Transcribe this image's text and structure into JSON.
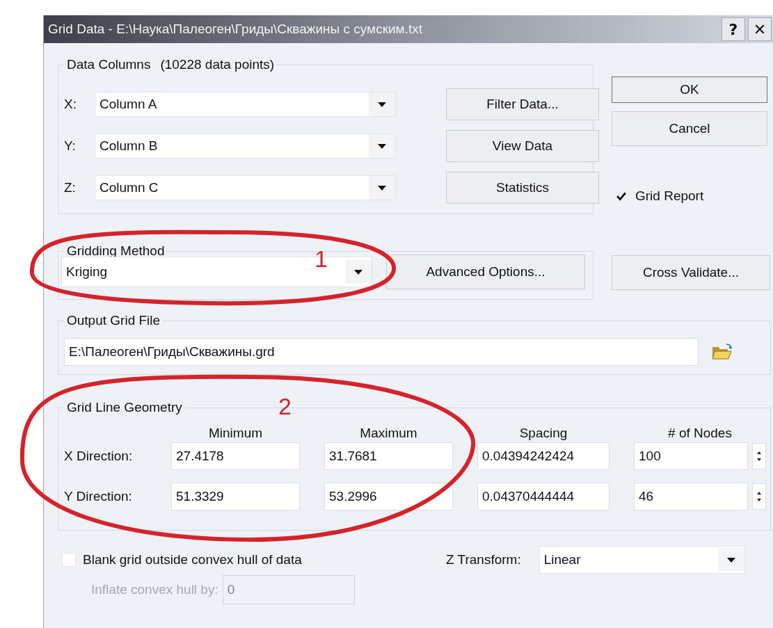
{
  "window": {
    "title": "Grid Data - E:\\Наука\\Палеоген\\Гриды\\Скважины с сумским.txt",
    "help": "?",
    "close": "✕"
  },
  "data_columns": {
    "label": "Data Columns",
    "count": "(10228 data points)",
    "rows": [
      {
        "axis": "X:",
        "value": "Column A",
        "button": "Filter Data..."
      },
      {
        "axis": "Y:",
        "value": "Column B",
        "button": "View Data"
      },
      {
        "axis": "Z:",
        "value": "Column C",
        "button": "Statistics"
      }
    ]
  },
  "dialog_buttons": [
    {
      "label": "OK",
      "default": true
    },
    {
      "label": "Cancel",
      "default": false
    }
  ],
  "grid_report": {
    "label": "Grid Report",
    "checked": true
  },
  "gridding_method": {
    "label": "Gridding Method",
    "value": "Kriging",
    "button": "Advanced Options..."
  },
  "cross_validate": "Cross Validate...",
  "output_grid_file": {
    "label": "Output Grid File",
    "value": "E:\\Палеоген\\Гриды\\Скважины.grd"
  },
  "grid_line_geometry": {
    "label": "Grid Line Geometry",
    "columns": [
      "Minimum",
      "Maximum",
      "Spacing",
      "# of Nodes"
    ],
    "rows": [
      {
        "label": "X Direction:",
        "minimum": "27.4178",
        "maximum": "31.7681",
        "spacing": "0.04394242424",
        "nodes": "100"
      },
      {
        "label": "Y Direction:",
        "minimum": "51.3329",
        "maximum": "53.2996",
        "spacing": "0.04370444444",
        "nodes": "46"
      }
    ]
  },
  "blank_grid": {
    "label": "Blank grid outside convex hull of data",
    "checked": false
  },
  "z_transform": {
    "label": "Z Transform:",
    "value": "Linear"
  },
  "inflate": {
    "label": "Inflate convex hull by:",
    "value": "0",
    "disabled": true
  },
  "annotations": [
    {
      "label": "1"
    },
    {
      "label": "2"
    }
  ]
}
